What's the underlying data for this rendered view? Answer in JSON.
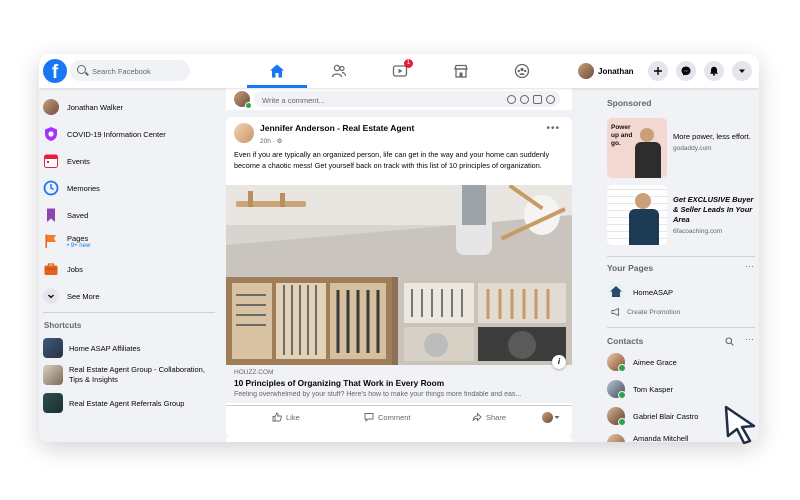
{
  "topbar": {
    "search_placeholder": "Search Facebook",
    "notification_badge": "1",
    "profile_name": "Jonathan"
  },
  "left_sidebar": {
    "items": [
      {
        "label": "Jonathan Walker",
        "icon": "profile-avatar"
      },
      {
        "label": "COVID-19 Information Center",
        "icon": "covid-shield-icon"
      },
      {
        "label": "Events",
        "icon": "calendar-icon"
      },
      {
        "label": "Memories",
        "icon": "clock-icon"
      },
      {
        "label": "Saved",
        "icon": "bookmark-icon"
      },
      {
        "label": "Pages",
        "icon": "flag-icon",
        "sub": "9+ new"
      },
      {
        "label": "Jobs",
        "icon": "briefcase-icon"
      },
      {
        "label": "See More",
        "icon": "chevron-down-icon"
      }
    ],
    "shortcuts_title": "Shortcuts",
    "shortcuts": [
      {
        "label": "Home ASAP Affiliates"
      },
      {
        "label": "Real Estate Agent Group - Collaboration, Tips & Insights"
      },
      {
        "label": "Real Estate Agent Referrals Group"
      }
    ]
  },
  "feed": {
    "comment_placeholder": "Write a comment...",
    "post": {
      "author": "Jennifer Anderson - Real Estate Agent",
      "time": "20h",
      "privacy_icon": "gear-icon",
      "text": "Even if you are typically an organized person, life can get in the way and your home can suddenly become a chaotic mess! Get yourself back on track with this list of 10 principles of organization.",
      "link": {
        "domain": "HOUZZ.COM",
        "title": "10 Principles of Organizing That Work in Every Room",
        "description": "Feeling overwhelmed by your stuff? Here's how to make your things more findable and eas..."
      },
      "actions": {
        "like": "Like",
        "comment": "Comment",
        "share": "Share"
      }
    }
  },
  "right_sidebar": {
    "sponsored_title": "Sponsored",
    "ads": [
      {
        "image_text": "Power up and go.",
        "text": "More power, less effort.",
        "domain": "godaddy.com"
      },
      {
        "text": "Get EXCLUSIVE Buyer & Seller Leads In Your Area",
        "domain": "6facoaching.com"
      }
    ],
    "pages_title": "Your Pages",
    "page": {
      "name": "HomeASAP",
      "action": "Create Promotion"
    },
    "contacts_title": "Contacts",
    "contacts": [
      {
        "name": "Aimee Grace"
      },
      {
        "name": "Tom Kasper"
      },
      {
        "name": "Gabriel Blair Castro"
      },
      {
        "name": "Amanda Mitchell"
      }
    ]
  },
  "colors": {
    "brand": "#1877f2",
    "background": "#f0f2f5",
    "online": "#31a24c",
    "badge": "#e41e3f"
  }
}
